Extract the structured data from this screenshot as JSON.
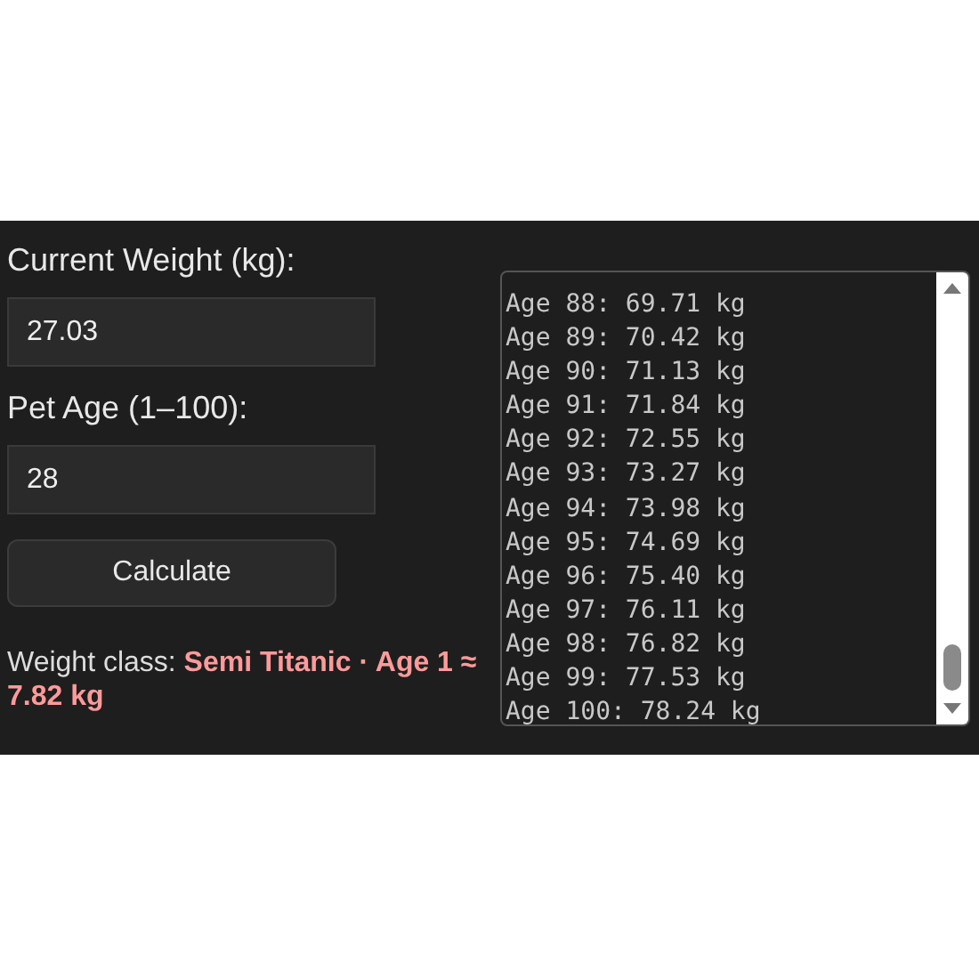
{
  "form": {
    "weight_label": "Current Weight (kg):",
    "weight_value": "27.03",
    "age_label": "Pet Age (1–100):",
    "age_value": "28",
    "button": "Calculate",
    "result": "Weight class: **Semi Titanic · Age 1 ≈ 7.82 kg**"
  },
  "log": {
    "lines": [
      "Age 88: 69.71 kg",
      "Age 89: 70.42 kg",
      "Age 90: 71.13 kg",
      "Age 91: 71.84 kg",
      "Age 92: 72.55 kg",
      "Age 93: 73.27 kg",
      "Age 94: 73.98 kg",
      "Age 95: 74.69 kg",
      "Age 96: 75.40 kg",
      "Age 97: 76.11 kg",
      "Age 98: 76.82 kg",
      "Age 99: 77.53 kg",
      "Age 100: 78.24 kg"
    ]
  }
}
